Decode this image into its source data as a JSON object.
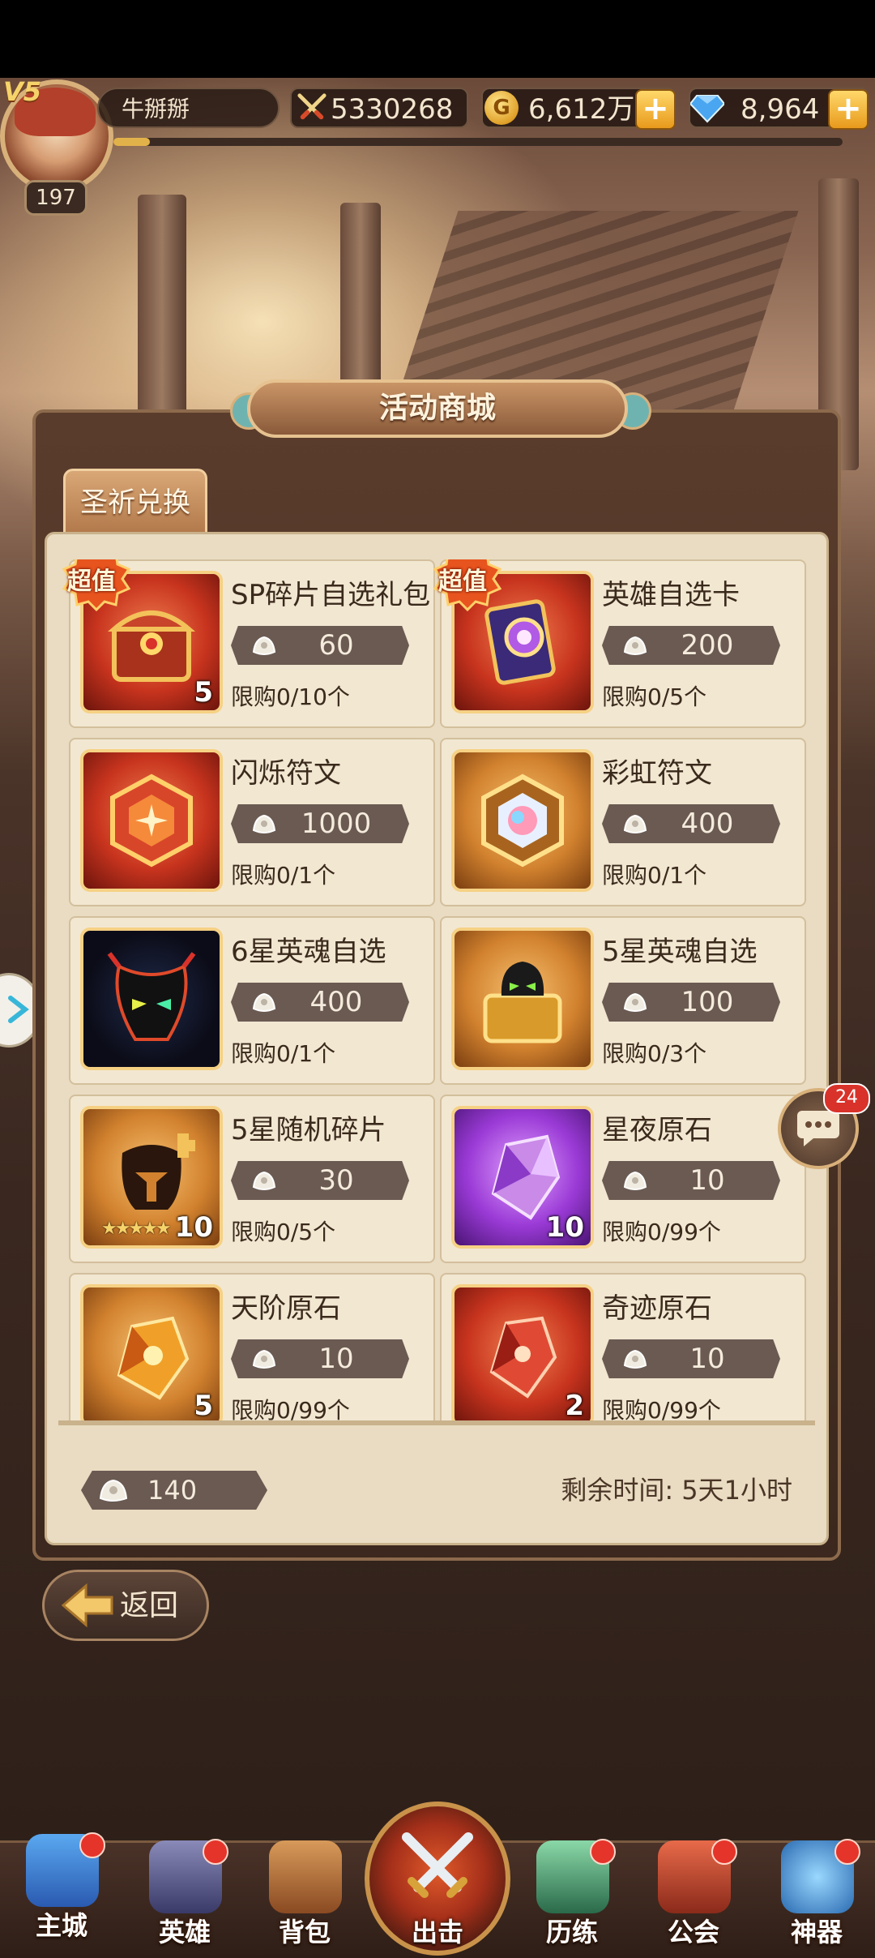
{
  "header": {
    "vip": "V5",
    "level": "197",
    "player_name": "牛掰掰",
    "combat_power": "5330268",
    "gold": "6,612万",
    "gold_symbol": "G",
    "gems": "8,964",
    "plus": "+"
  },
  "shop": {
    "title": "活动商城",
    "tab": "圣祈兑换",
    "badge": "超值",
    "items": [
      {
        "name": "SP碎片自选礼包",
        "price": "60",
        "limit": "限购0/10个",
        "count": "5",
        "badge": true
      },
      {
        "name": "英雄自选卡",
        "price": "200",
        "limit": "限购0/5个",
        "count": "",
        "badge": true
      },
      {
        "name": "闪烁符文",
        "price": "1000",
        "limit": "限购0/1个",
        "count": ""
      },
      {
        "name": "彩虹符文",
        "price": "400",
        "limit": "限购0/1个",
        "count": ""
      },
      {
        "name": "6星英魂自选",
        "price": "400",
        "limit": "限购0/1个",
        "count": ""
      },
      {
        "name": "5星英魂自选",
        "price": "100",
        "limit": "限购0/3个",
        "count": ""
      },
      {
        "name": "5星随机碎片",
        "price": "30",
        "limit": "限购0/5个",
        "count": "10",
        "stars": "★★★★★"
      },
      {
        "name": "星夜原石",
        "price": "10",
        "limit": "限购0/99个",
        "count": "10"
      },
      {
        "name": "天阶原石",
        "price": "10",
        "limit": "限购0/99个",
        "count": "5"
      },
      {
        "name": "奇迹原石",
        "price": "10",
        "limit": "限购0/99个",
        "count": "2"
      }
    ],
    "balance": "140",
    "remaining_time": "剩余时间: 5天1小时"
  },
  "back_label": "返回",
  "chat_badge": "24",
  "nav": {
    "items": [
      "主城",
      "英雄",
      "背包",
      "出击",
      "历练",
      "公会",
      "神器"
    ]
  },
  "colors": {
    "accent_gold": "#f6d184",
    "red_dot": "#e5342a",
    "panel_bg": "#e9dcc2"
  },
  "icons": [
    "power-swords-icon",
    "gold-coin-icon",
    "gem-icon",
    "blessing-currency-icon",
    "chat-icon",
    "back-arrow-icon"
  ]
}
